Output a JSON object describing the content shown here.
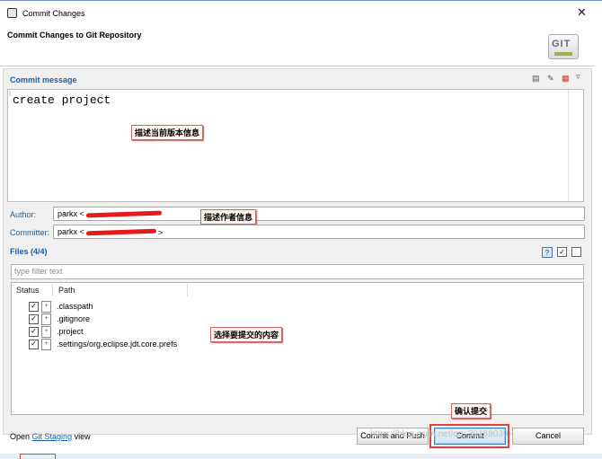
{
  "window": {
    "title": "Commit Changes"
  },
  "header": {
    "title": "Commit Changes to Git Repository",
    "logo_text": "GIT"
  },
  "commit_message": {
    "section_label": "Commit message",
    "text": "create project",
    "annotation": "描述当前版本信息"
  },
  "author": {
    "label": "Author:",
    "value": "parkx <"
  },
  "committer": {
    "label": "Committer:",
    "value": "parkx <",
    "value_suffix": ">"
  },
  "author_annotation": "描述作者信息",
  "files": {
    "section_label": "Files (4/4)",
    "filter_placeholder": "type filter text",
    "columns": {
      "status": "Status",
      "path": "Path"
    },
    "rows": [
      {
        "name": ".classpath",
        "checked": true
      },
      {
        "name": ".gitignore",
        "checked": true
      },
      {
        "name": ".project",
        "checked": true
      },
      {
        "name": ".settings/org.eclipse.jdt.core.prefs",
        "checked": true
      }
    ],
    "annotation": "选择要提交的内容"
  },
  "footer": {
    "open_prefix": "Open",
    "staging_link": "Git Staging",
    "view_suffix": "view",
    "commit_and_push": "Commit and Push",
    "commit": "Commit",
    "cancel": "Cancel",
    "commit_annotation": "确认提交"
  },
  "watermark": "https://blog.csdn.net/qq_39188039",
  "icons": {
    "close": "close-icon",
    "app": "eclipse-app-icon",
    "checkbox": "checkbox-checked-icon",
    "file": "file-added-icon"
  }
}
